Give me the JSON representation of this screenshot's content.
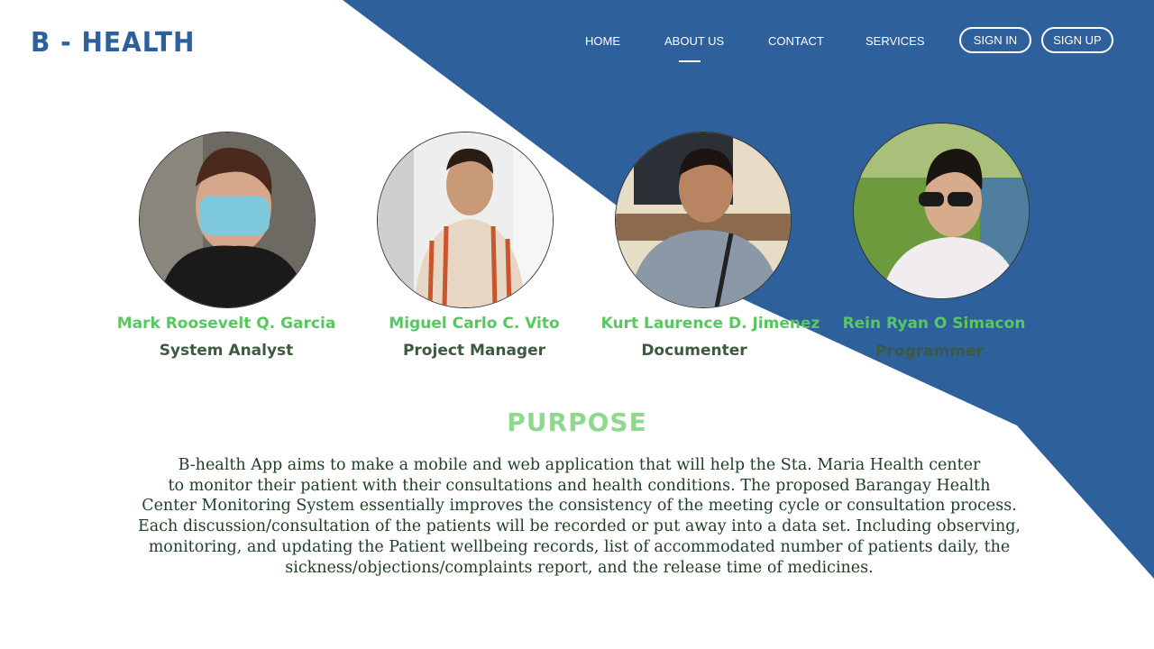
{
  "brand": {
    "logo_text": "B - HEALTH",
    "primary_color": "#2e609b",
    "accent_green": "#59c760"
  },
  "nav": {
    "items": [
      {
        "label": "HOME",
        "active": false
      },
      {
        "label": "ABOUT US",
        "active": true
      },
      {
        "label": "CONTACT",
        "active": false
      },
      {
        "label": "SERVICES",
        "active": false
      }
    ],
    "sign_in_label": "SIGN IN",
    "sign_up_label": "SIGN UP"
  },
  "team": [
    {
      "name": "Mark Roosevelt Q. Garcia",
      "role": "System Analyst"
    },
    {
      "name": "Miguel Carlo C. Vito",
      "role": "Project Manager"
    },
    {
      "name": "Kurt Laurence D. Jimenez",
      "role": "Documenter"
    },
    {
      "name": "Rein Ryan O Simacon",
      "role": "Programmer"
    }
  ],
  "purpose": {
    "title": "PURPOSE",
    "lines": [
      "B-health App aims to make a mobile and web application that will help the Sta. Maria Health center",
      "to monitor their patient with their consultations and health conditions. The proposed Barangay Health",
      "Center Monitoring System essentially improves the consistency of the meeting cycle or consultation process.",
      "Each discussion/consultation of the patients will be recorded or put away into a data set. Including observing,",
      "monitoring, and updating the Patient wellbeing records, list of accommodated number of patients daily, the",
      "sickness/objections/complaints report, and the release time of medicines."
    ]
  }
}
